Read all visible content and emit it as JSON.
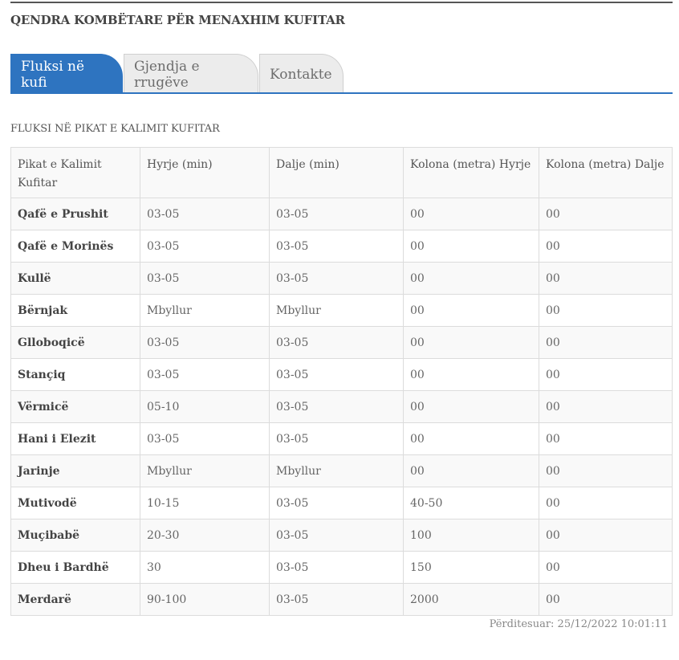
{
  "page": {
    "title": "QENDRA KOMBËTARE PËR MENAXHIM KUFITAR"
  },
  "tabs": [
    {
      "label": "Fluksi në kufi",
      "active": true
    },
    {
      "label": "Gjendja e rrugëve",
      "active": false
    },
    {
      "label": "Kontakte",
      "active": false
    }
  ],
  "section": {
    "title": "FLUKSI NË PIKAT E KALIMIT KUFITAR"
  },
  "table": {
    "headers": [
      "Pikat e Kalimit Kufitar",
      "Hyrje (min)",
      "Dalje (min)",
      "Kolona (metra) Hyrje",
      "Kolona (metra) Dalje"
    ],
    "rows": [
      [
        "Qafë e Prushit",
        "03-05",
        "03-05",
        "00",
        "00"
      ],
      [
        "Qafë e Morinës",
        "03-05",
        "03-05",
        "00",
        "00"
      ],
      [
        "Kullë",
        "03-05",
        "03-05",
        "00",
        "00"
      ],
      [
        "Bërnjak",
        "Mbyllur",
        "Mbyllur",
        "00",
        "00"
      ],
      [
        "Glloboqicë",
        "03-05",
        "03-05",
        "00",
        "00"
      ],
      [
        "Stançiq",
        "03-05",
        "03-05",
        "00",
        "00"
      ],
      [
        "Vërmicë",
        "05-10",
        "03-05",
        "00",
        "00"
      ],
      [
        "Hani i Elezit",
        "03-05",
        "03-05",
        "00",
        "00"
      ],
      [
        "Jarinje",
        "Mbyllur",
        "Mbyllur",
        "00",
        "00"
      ],
      [
        "Mutivodë",
        "10-15",
        "03-05",
        "40-50",
        "00"
      ],
      [
        "Muçibabë",
        "20-30",
        "03-05",
        "100",
        "00"
      ],
      [
        "Dheu i Bardhë",
        "30",
        "03-05",
        "150",
        "00"
      ],
      [
        "Merdarë",
        "90-100",
        "03-05",
        "2000",
        "00"
      ]
    ]
  },
  "footer": {
    "updated": "Përditesuar: 25/12/2022 10:01:11"
  },
  "colors": {
    "accent": "#2e74c0",
    "tab_inactive_bg": "#ececec",
    "border": "#dcdcdc"
  }
}
